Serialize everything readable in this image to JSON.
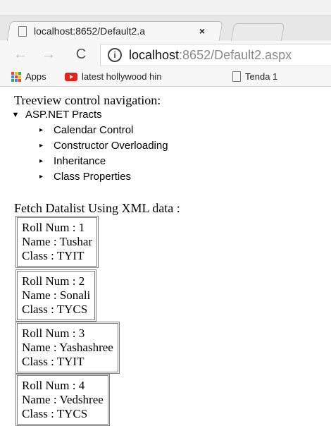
{
  "browser": {
    "tab": {
      "title": "localhost:8652/Default2.a",
      "close": "×"
    },
    "address": {
      "host": "localhost",
      "rest": ":8652/Default2.aspx"
    },
    "bookmarks": [
      {
        "label": "Apps"
      },
      {
        "label": "latest hollywood hin"
      },
      {
        "label": "Tenda 1"
      }
    ]
  },
  "page": {
    "treeview_heading": "Treeview control navigation:",
    "tree": {
      "root": "ASP.NET Practs",
      "children": [
        "Calendar Control",
        "Constructor Overloading",
        "Inheritance",
        "Class Properties"
      ]
    },
    "datalist_heading": "Fetch Datalist Using XML data :",
    "students": [
      {
        "roll": "Roll Num : 1",
        "name": "Name : Tushar",
        "class": "Class : TYIT"
      },
      {
        "roll": "Roll Num : 2",
        "name": "Name : Sonali",
        "class": "Class : TYCS"
      },
      {
        "roll": "Roll Num : 3",
        "name": "Name : Yashashree",
        "class": "Class : TYIT"
      },
      {
        "roll": "Roll Num : 4",
        "name": "Name : Vedshree",
        "class": "Class : TYCS"
      }
    ]
  },
  "icons": {
    "back": "arrow-left-icon",
    "forward": "arrow-right-icon",
    "reload": "reload-icon",
    "info": "info-icon",
    "tab_page": "page-icon",
    "apps": "apps-grid-icon",
    "youtube": "youtube-icon",
    "bookmark_page": "page-icon"
  },
  "colors": {
    "accent_red": "#e62117",
    "text_gray": "#8a8a8a",
    "border_gray": "#7f7f7f"
  }
}
